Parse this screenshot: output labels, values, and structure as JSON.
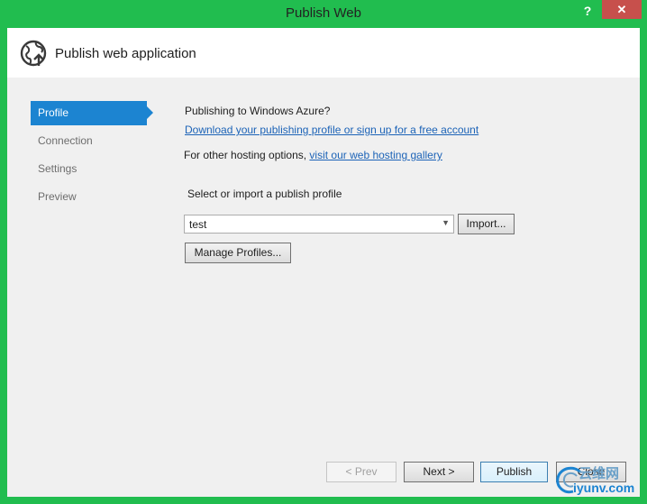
{
  "window": {
    "title": "Publish Web",
    "help_label": "?",
    "close_label": "✕"
  },
  "header": {
    "icon": "globe-publish-icon",
    "title": "Publish web application"
  },
  "sidebar": {
    "items": [
      {
        "label": "Profile",
        "active": true
      },
      {
        "label": "Connection",
        "active": false
      },
      {
        "label": "Settings",
        "active": false
      },
      {
        "label": "Preview",
        "active": false
      }
    ]
  },
  "main": {
    "azure_question": "Publishing to Windows Azure?",
    "azure_link": "Download your publishing profile or sign up for a free account",
    "hosting_prefix": "For other hosting options, ",
    "hosting_link": "visit our web hosting gallery",
    "select_label": "Select or import a publish profile",
    "profile_value": "test",
    "import_label": "Import...",
    "manage_label": "Manage Profiles..."
  },
  "footer": {
    "prev_label": "< Prev",
    "next_label": "Next >",
    "publish_label": "Publish",
    "close_label": "Close"
  },
  "watermark": {
    "cn": "云维网",
    "en": "iyunv.com"
  },
  "colors": {
    "frame": "#21bd4f",
    "accent": "#1c84d1",
    "link": "#1c63b7",
    "close_button": "#c7504c"
  }
}
